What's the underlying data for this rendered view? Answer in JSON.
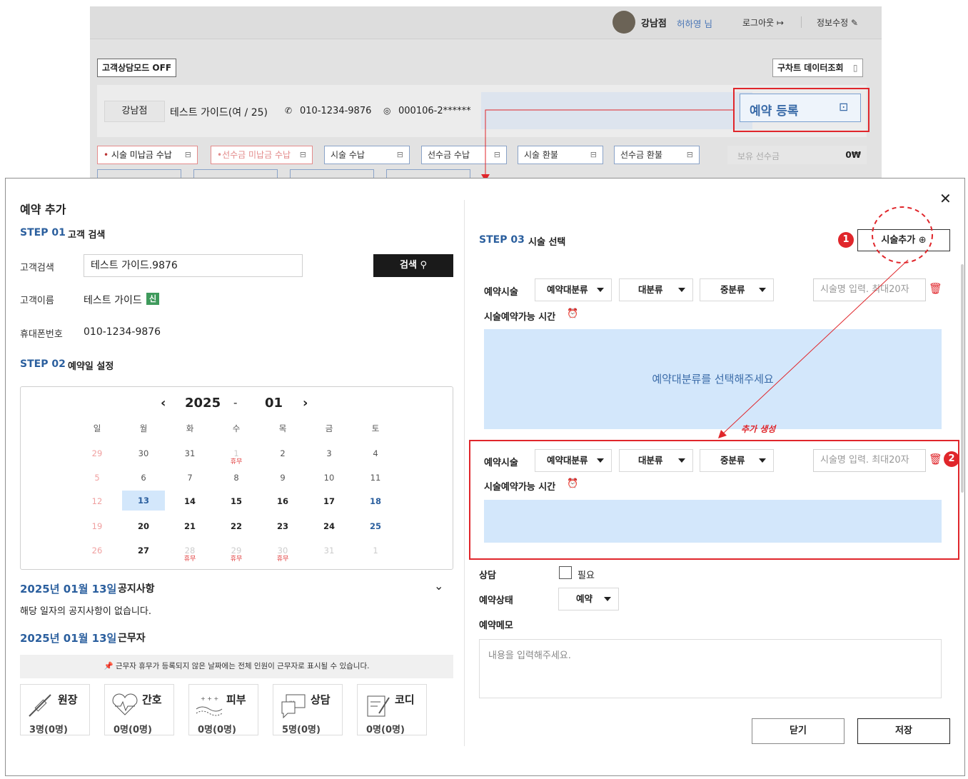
{
  "header": {
    "branch": "강남점",
    "user": "허하영 님",
    "logout": "로그아웃",
    "edit_info": "정보수정"
  },
  "toolbar": {
    "consult_mode": "고객상담모드 OFF",
    "old_chart": "구차트 데이터조회"
  },
  "customer_bar": {
    "branch": "강남점",
    "name": "테스트 가이드(여 / 25)",
    "phone": "010-1234-9876",
    "rrn": "000106-2******",
    "reserve_button": "예약 등록"
  },
  "payment_pills": {
    "unpaid_treat": "시술 미납금 수납",
    "unpaid_deposit": "선수금 미납금 수납",
    "treat_receive": "시술 수납",
    "deposit_receive": "선수금 수납",
    "treat_refund": "시술 환불",
    "deposit_refund": "선수금 환불",
    "held_deposit_label": "보유 선수금",
    "held_deposit_value": "0₩"
  },
  "modal": {
    "title": "예약 추가",
    "step01": {
      "num": "STEP 01",
      "title": "고객 검색"
    },
    "search_label": "고객검색",
    "search_value": "테스트 가이드.9876",
    "search_button": "검색",
    "name_label": "고객이름",
    "name_value": "테스트 가이드",
    "new_badge": "신",
    "phone_label": "휴대폰번호",
    "phone_value": "010-1234-9876",
    "step02": {
      "num": "STEP 02",
      "title": "예약일 설정"
    },
    "calendar": {
      "year": "2025",
      "sep": "-",
      "month": "01",
      "weekdays": [
        "일",
        "월",
        "화",
        "수",
        "목",
        "금",
        "토"
      ],
      "holiday_text": "휴무"
    },
    "notice_date": "2025년 01월 13일",
    "notice_title": "공지사항",
    "notice_text": "해당 일자의 공지사항이 없습니다.",
    "staff_date": "2025년 01월 13일",
    "staff_title": "근무자",
    "staff_info": "근무자 휴무가 등록되지 않은 날짜에는 전체 인원이 근무자로 표시될 수 있습니다.",
    "staff": [
      {
        "role": "원장",
        "count": "3명(0명)",
        "icon": "syringe-icon"
      },
      {
        "role": "간호",
        "count": "0명(0명)",
        "icon": "heartbeat-icon"
      },
      {
        "role": "피부",
        "count": "0명(0명)",
        "icon": "skin-icon"
      },
      {
        "role": "상담",
        "count": "5명(0명)",
        "icon": "chat-icon"
      },
      {
        "role": "코디",
        "count": "0명(0명)",
        "icon": "clipboard-icon"
      }
    ],
    "step03": {
      "num": "STEP 03",
      "title": "시술 선택"
    },
    "add_treatment": "시술추가",
    "treat_label": "예약시술",
    "dd_main": "예약대분류",
    "dd_large": "대분류",
    "dd_mid": "중분류",
    "treat_name_placeholder": "시술명 입력. 최대20자",
    "avail_time": "시술예약가능 시간",
    "select_prompt": "예약대분류를 선택해주세요",
    "added_note": "추가 생성",
    "consult_label": "상담",
    "consult_check": "필요",
    "status_label": "예약상태",
    "status_value": "예약",
    "memo_label": "예약메모",
    "memo_placeholder": "내용을 입력해주세요.",
    "close_button": "닫기",
    "save_button": "저장",
    "badge1": "1",
    "badge2": "2"
  }
}
